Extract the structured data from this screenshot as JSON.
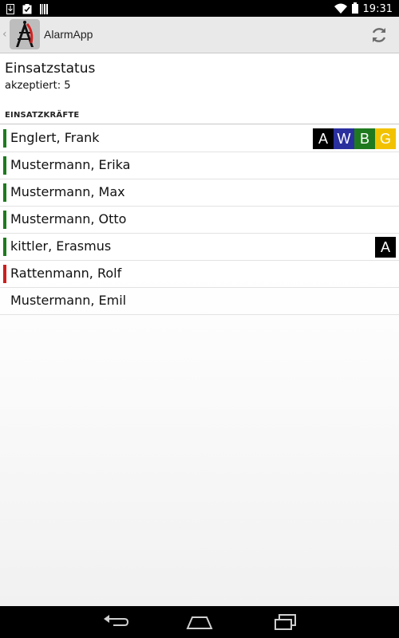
{
  "status_bar": {
    "time": "19:31",
    "icons": [
      "download-icon",
      "clipboard-icon",
      "barcode-icon",
      "wifi-icon",
      "battery-icon"
    ]
  },
  "action_bar": {
    "title": "AlarmApp",
    "icons": [
      "app-icon",
      "refresh-icon"
    ]
  },
  "status": {
    "title": "Einsatzstatus",
    "accepted": "akzeptiert: 5"
  },
  "section": {
    "header": "EINSATZKRÄFTE"
  },
  "colors": {
    "green": "#1f7a1f",
    "red": "#cc1f1f",
    "badge_A": "#000000",
    "badge_W": "#2a2f9e",
    "badge_B": "#1f7a1f",
    "badge_G": "#f2c200"
  },
  "members": [
    {
      "name": "Englert, Frank",
      "status": "green",
      "badges": [
        "A",
        "W",
        "B",
        "G"
      ]
    },
    {
      "name": "Mustermann, Erika",
      "status": "green",
      "badges": []
    },
    {
      "name": "Mustermann, Max",
      "status": "green",
      "badges": []
    },
    {
      "name": "Mustermann, Otto",
      "status": "green",
      "badges": []
    },
    {
      "name": "kittler, Erasmus",
      "status": "green",
      "badges": [
        "A"
      ]
    },
    {
      "name": "Rattenmann, Rolf",
      "status": "red",
      "badges": []
    },
    {
      "name": "Mustermann, Emil",
      "status": "none",
      "badges": []
    }
  ],
  "nav_bar": {
    "icons": [
      "back-icon",
      "home-icon",
      "recent-apps-icon"
    ]
  }
}
